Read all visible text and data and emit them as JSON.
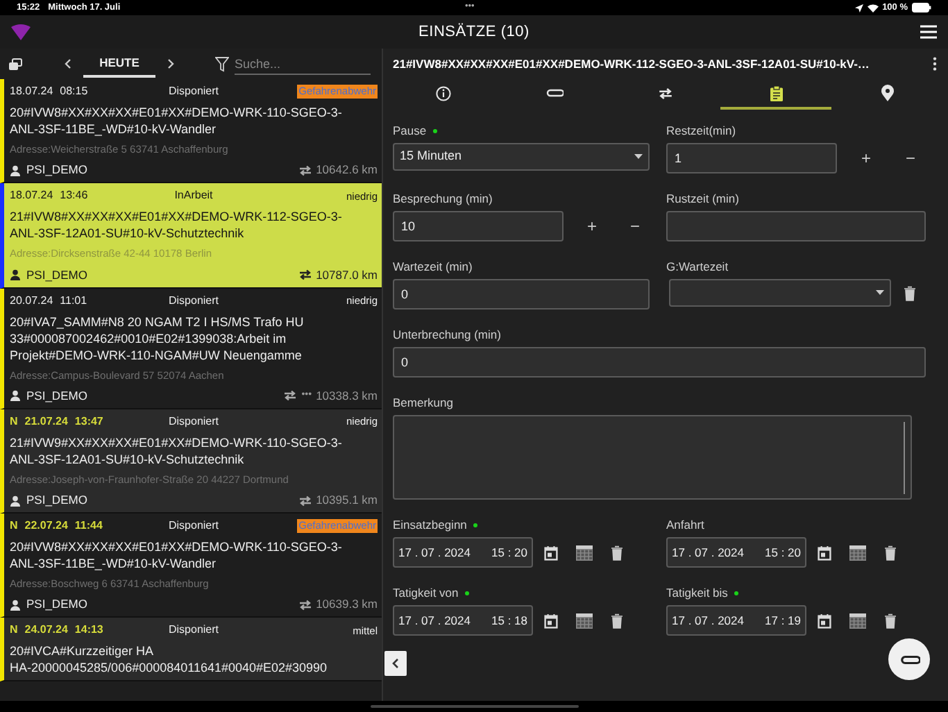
{
  "status_bar": {
    "time": "15:22",
    "date": "Mittwoch 17. Juli",
    "dots": "•••",
    "battery": "100 %"
  },
  "header": {
    "title": "EINSÄTZE (10)"
  },
  "list_toolbar": {
    "tab": "HEUTE",
    "search_placeholder": "Suche..."
  },
  "orders": [
    {
      "selected": false,
      "date": "18.07.24",
      "time": "08:15",
      "status": "Disponiert",
      "priority": {
        "kind": "badge",
        "text": "Gefahrenabwehr"
      },
      "title_lines": [
        "20#IVW8#XX#XX#XX#E01#XX#DEMO-WRK-110-SGEO-3-",
        "ANL-3SF-11BE_-WD#10-kV-Wandler"
      ],
      "address": "Adresse:Weicherstraße 5 63741 Aschaffenburg",
      "user": "PSI_DEMO",
      "distance": "10642.6 km"
    },
    {
      "selected": true,
      "date": "18.07.24",
      "time": "13:46",
      "status": "InArbeit",
      "priority": {
        "kind": "text",
        "text": "niedrig"
      },
      "title_lines": [
        "21#IVW8#XX#XX#XX#E01#XX#DEMO-WRK-112-SGEO-3-",
        "ANL-3SF-12A01-SU#10-kV-Schutztechnik"
      ],
      "address": "Adresse:Dircksenstraße 42-44 10178 Berlin",
      "user": "PSI_DEMO",
      "distance": "10787.0 km"
    },
    {
      "selected": false,
      "date": "20.07.24",
      "time": "11:01",
      "status": "Disponiert",
      "priority": {
        "kind": "text",
        "text": "niedrig"
      },
      "title_lines": [
        "20#IVA7_SAMM#N8 20 NGAM T2 I HS/MS Trafo HU",
        "33#000087002462#0010#E02#1399038:Arbeit im",
        "Projekt#DEMO-WRK-110-NGAM#UW Neuengamme"
      ],
      "address": "Adresse:Campus-Boulevard 57 52074 Aachen",
      "user": "PSI_DEMO",
      "route_dots": "•••",
      "distance": "10338.3 km"
    },
    {
      "selected": false,
      "flag": "N",
      "date": "21.07.24",
      "time": "13:47",
      "status": "Disponiert",
      "priority": {
        "kind": "text",
        "text": "niedrig"
      },
      "title_lines": [
        "21#IVW9#XX#XX#XX#E01#XX#DEMO-WRK-110-SGEO-3-",
        "ANL-3SF-12A01-SU#10-kV-Schutztechnik"
      ],
      "address": "Adresse:Joseph-von-Fraunhofer-Straße 20 44227 Dortmund",
      "user": "PSI_DEMO",
      "distance": "10395.1 km"
    },
    {
      "selected": false,
      "flag": "N",
      "date": "22.07.24",
      "time": "11:44",
      "status": "Disponiert",
      "priority": {
        "kind": "badge",
        "text": "Gefahrenabwehr"
      },
      "title_lines": [
        "20#IVW8#XX#XX#XX#E01#XX#DEMO-WRK-110-SGEO-3-",
        "ANL-3SF-11BE_-WD#10-kV-Wandler"
      ],
      "address": "Adresse:Boschweg 6 63741 Aschaffenburg",
      "user": "PSI_DEMO",
      "distance": "10639.3 km"
    },
    {
      "selected": false,
      "flag": "N",
      "date": "24.07.24",
      "time": "14:13",
      "status": "Disponiert",
      "priority": {
        "kind": "text",
        "text": "mittel"
      },
      "title_lines": [
        "20#IVCA#Kurzzeitiger HA",
        "HA-20000045285/006#000084011641#0040#E02#30990"
      ]
    }
  ],
  "detail": {
    "title": "21#IVW8#XX#XX#XX#E01#XX#DEMO-WRK-112-SGEO-3-ANL-3SF-12A01-SU#10-kV-…",
    "tabs": [
      {
        "kind": "info",
        "selected": false
      },
      {
        "kind": "attachment",
        "selected": false
      },
      {
        "kind": "route",
        "selected": false
      },
      {
        "kind": "clipboard",
        "selected": true
      },
      {
        "kind": "location",
        "selected": false
      }
    ],
    "fields": [
      {
        "kind": "select",
        "label": "Pause",
        "required": true,
        "value": "15 Minuten"
      },
      {
        "kind": "stepper",
        "label": "Restzeit(min)",
        "required": false,
        "value": "1",
        "increment": "+",
        "decrement": "−"
      },
      {
        "kind": "stepper",
        "label": "Besprechung (min)",
        "required": false,
        "value": "10",
        "increment": "+",
        "decrement": "−"
      },
      {
        "kind": "text",
        "label": "Rustzeit (min)",
        "required": false
      },
      {
        "kind": "text",
        "label": "Wartezeit (min)",
        "required": false,
        "value": "0"
      },
      {
        "kind": "select_delete",
        "label": "G:Wartezeit",
        "required": false
      },
      {
        "kind": "wide_text",
        "label": "Unterbrechung (min)",
        "required": false,
        "value": "0"
      },
      {
        "kind": "textarea",
        "label": "Bemerkung",
        "required": false
      },
      {
        "kind": "datetime",
        "label": "Einsatzbeginn",
        "required": true,
        "date": "17 . 07 . 2024",
        "time": "15 : 20"
      },
      {
        "kind": "datetime",
        "label": "Anfahrt",
        "required": false,
        "date": "17 . 07 . 2024",
        "time": "15 : 20"
      },
      {
        "kind": "datetime",
        "label": "Tatigkeit von",
        "required": true,
        "date": "17 . 07 . 2024",
        "time": "15 : 18"
      },
      {
        "kind": "datetime",
        "label": "Tatigkeit bis",
        "required": true,
        "date": "17 . 07 . 2024",
        "time": "17 : 19"
      }
    ]
  }
}
